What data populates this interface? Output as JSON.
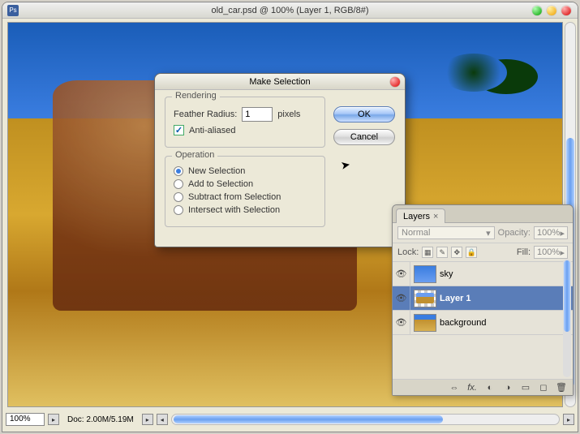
{
  "titlebar": {
    "title": "old_car.psd @ 100% (Layer 1, RGB/8#)",
    "ps": "Ps"
  },
  "dialog": {
    "title": "Make Selection",
    "rendering": {
      "legend": "Rendering",
      "feather_label": "Feather Radius:",
      "feather_value": "1",
      "feather_unit": "pixels",
      "aa_label": "Anti-aliased",
      "aa_checked": true
    },
    "operation": {
      "legend": "Operation",
      "opts": {
        "new": "New Selection",
        "add": "Add to Selection",
        "sub": "Subtract from Selection",
        "int": "Intersect with Selection"
      },
      "selected": "new"
    },
    "buttons": {
      "ok": "OK",
      "cancel": "Cancel"
    }
  },
  "layers": {
    "tab": "Layers",
    "blend_mode": "Normal",
    "opacity_label": "Opacity:",
    "opacity_value": "100%",
    "lock_label": "Lock:",
    "fill_label": "Fill:",
    "fill_value": "100%",
    "items": [
      {
        "name": "sky",
        "visible": true,
        "selected": false,
        "thumb": "sky"
      },
      {
        "name": "Layer 1",
        "visible": true,
        "selected": true,
        "thumb": "checker"
      },
      {
        "name": "background",
        "visible": true,
        "selected": false,
        "thumb": "bg"
      }
    ]
  },
  "status": {
    "zoom": "100%",
    "doc": "Doc: 2.00M/5.19M"
  }
}
